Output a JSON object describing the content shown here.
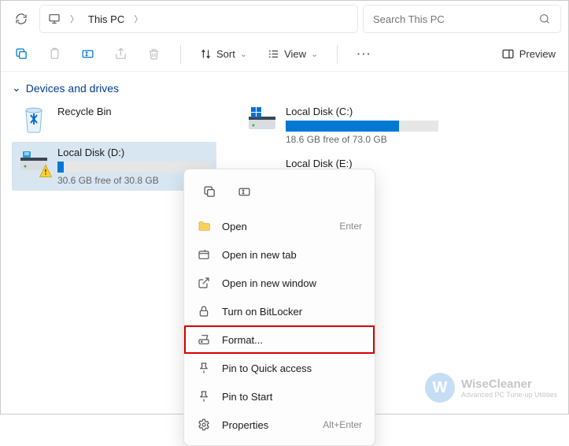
{
  "breadcrumb": {
    "location": "This PC"
  },
  "search": {
    "placeholder": "Search This PC"
  },
  "toolbar": {
    "sort": "Sort",
    "view": "View",
    "preview": "Preview"
  },
  "section": {
    "title": "Devices and drives"
  },
  "items": {
    "recycle": {
      "name": "Recycle Bin"
    },
    "d": {
      "name": "Local Disk (D:)",
      "free": "30.6 GB free of 30.8 GB",
      "pct": 4
    },
    "c": {
      "name": "Local Disk (C:)",
      "free": "18.6 GB free of 73.0 GB",
      "pct": 74
    },
    "e": {
      "name": "Local Disk (E:)"
    }
  },
  "ctx": {
    "open": "Open",
    "open_hint": "Enter",
    "tab": "Open in new tab",
    "win": "Open in new window",
    "bitlocker": "Turn on BitLocker",
    "format": "Format...",
    "pin_qa": "Pin to Quick access",
    "pin_start": "Pin to Start",
    "props": "Properties",
    "props_hint": "Alt+Enter"
  },
  "watermark": {
    "name": "WiseCleaner",
    "tag": "Advanced PC Tune-up Utilities"
  }
}
